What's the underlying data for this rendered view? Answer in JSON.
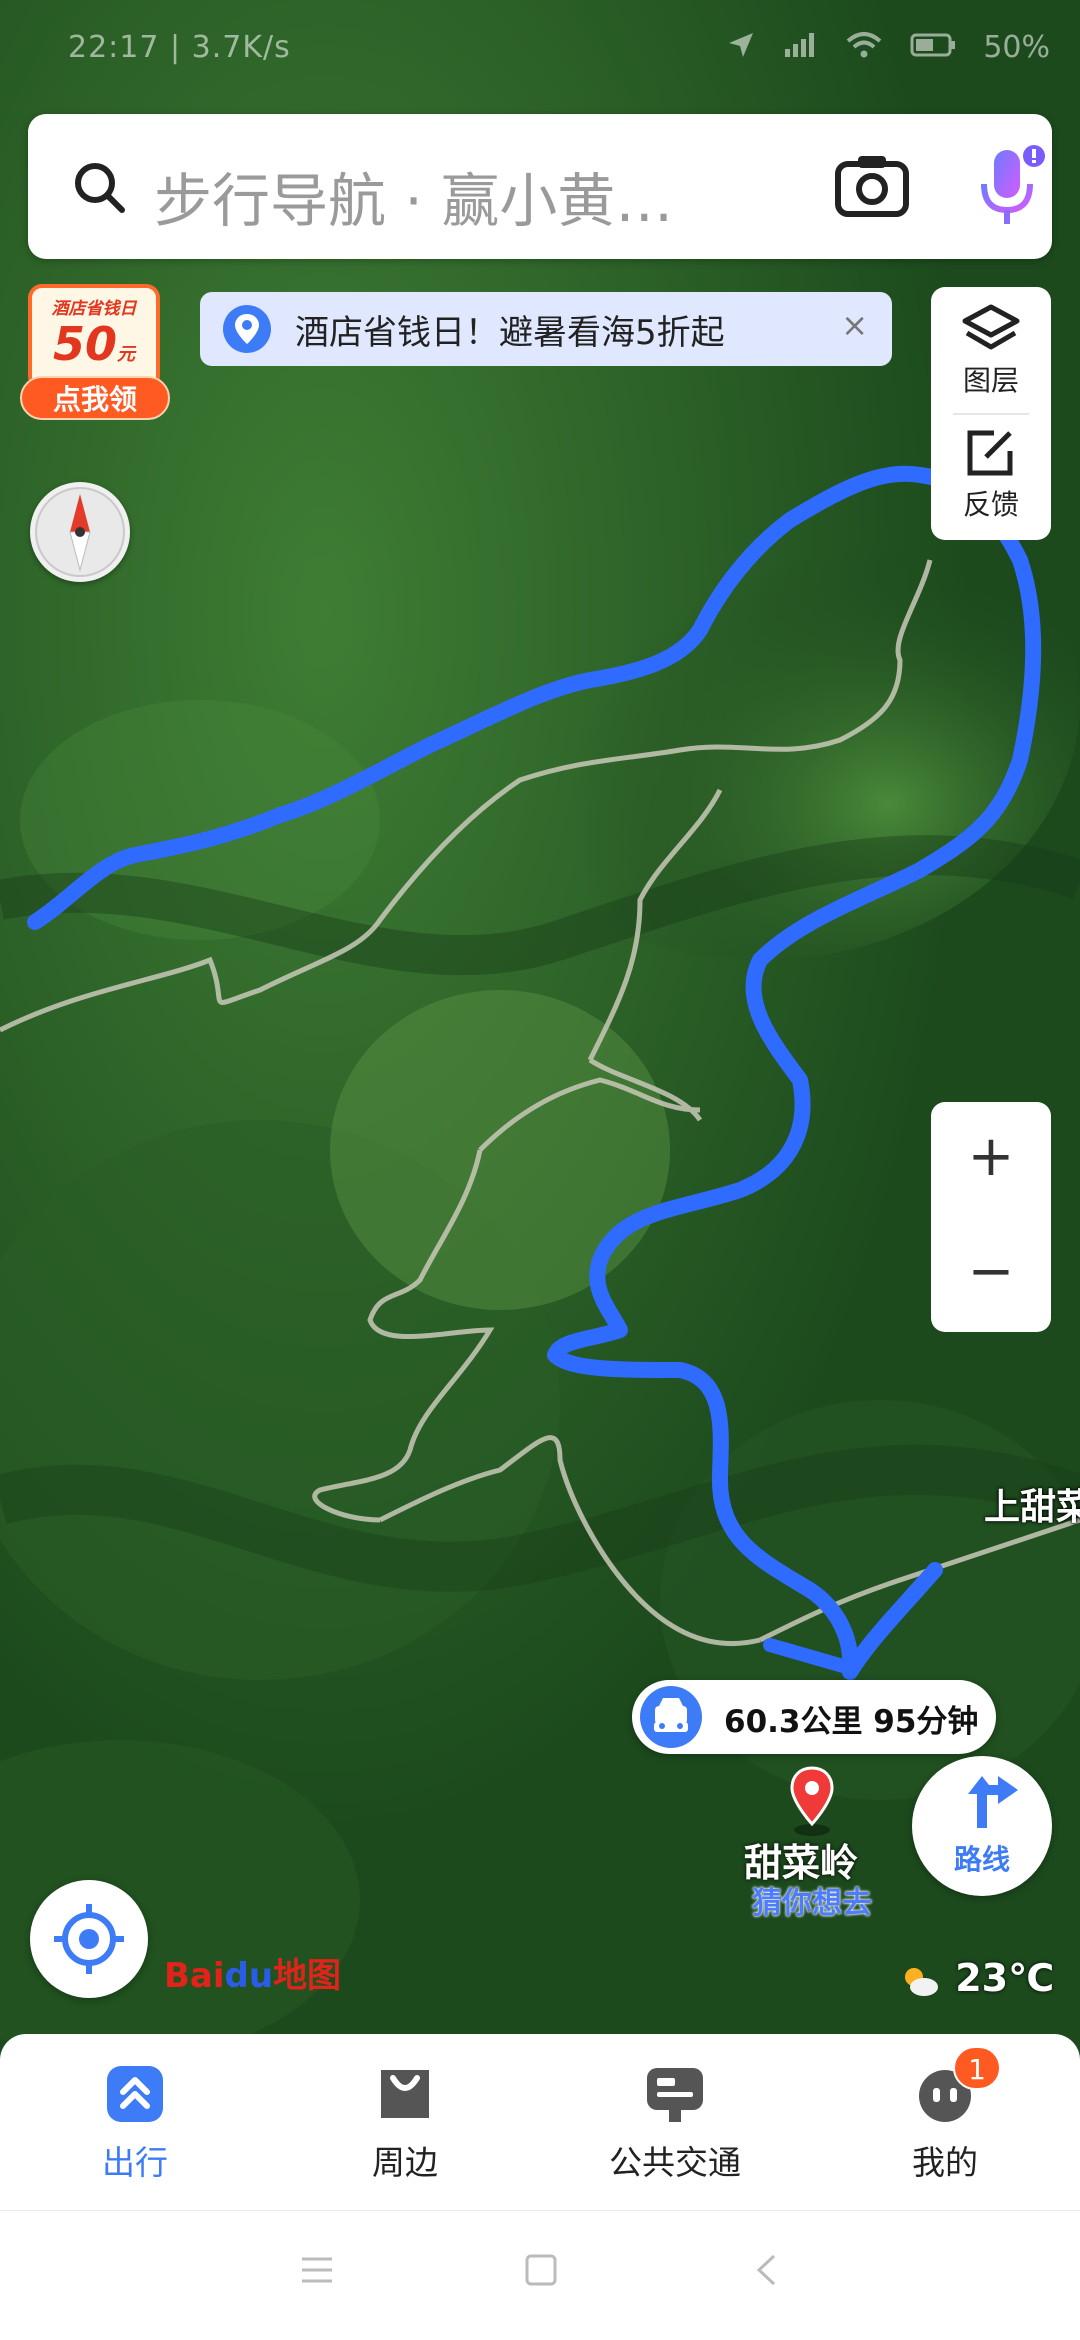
{
  "status_bar": {
    "time_speed": "22:17 | 3.7K/s",
    "battery": "50%"
  },
  "search": {
    "placeholder": "步行导航 · 赢小黄…"
  },
  "coupon": {
    "top_text": "酒店省钱日",
    "amount": "50",
    "unit": "元",
    "cta": "点我领"
  },
  "banner": {
    "text": "酒店省钱日！避暑看海5折起",
    "close": "×"
  },
  "tools": {
    "layers_label": "图层",
    "feedback_label": "反馈"
  },
  "zoom": {
    "in": "+",
    "out": "−"
  },
  "map": {
    "place_label": "上甜菜",
    "route_info": "60.3公里 95分钟",
    "destination_name": "甜菜岭",
    "destination_sub": "猜你想去",
    "route_button_label": "路线",
    "logo_brand": "Bai",
    "logo_du": "du",
    "logo_suffix": "地图",
    "weather_temp": "23℃"
  },
  "bottom_nav": {
    "tabs": [
      {
        "label": "出行",
        "icon": "travel-icon"
      },
      {
        "label": "周边",
        "icon": "bag-icon"
      },
      {
        "label": "公共交通",
        "icon": "bus-icon"
      },
      {
        "label": "我的",
        "icon": "profile-icon",
        "badge": "1"
      }
    ]
  },
  "colors": {
    "route": "#2f6bff",
    "accent": "#3e7cf7",
    "badge": "#ff5a22"
  }
}
